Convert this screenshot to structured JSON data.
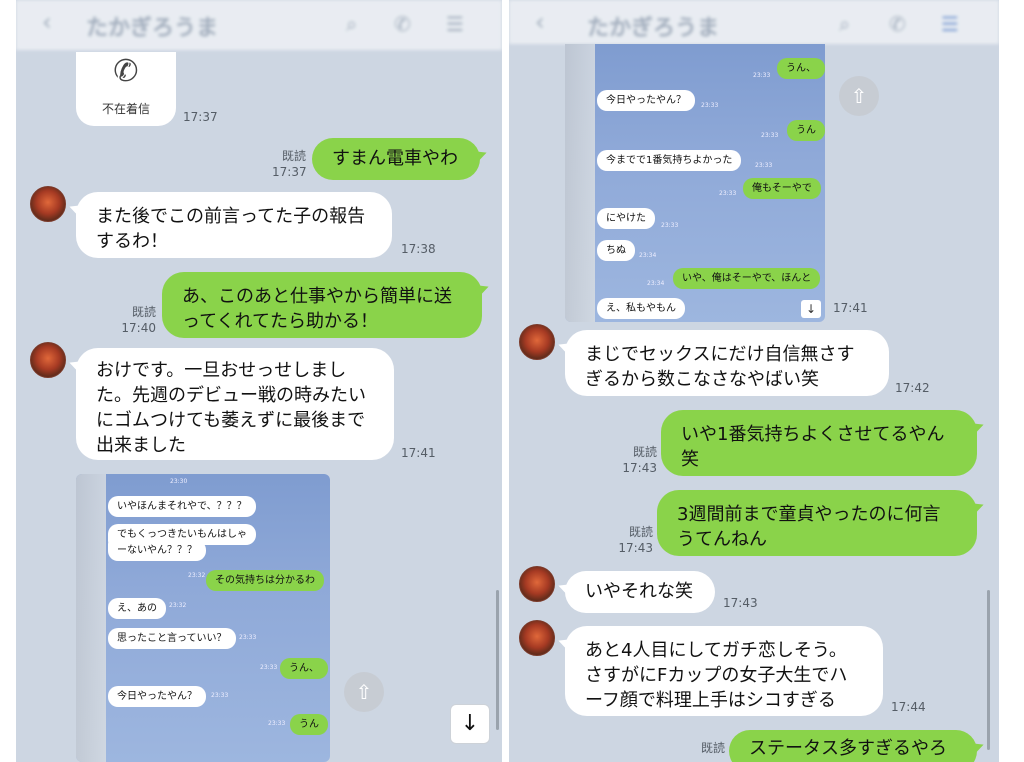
{
  "header": {
    "title": "たかぎろうま"
  },
  "left": {
    "missed_call": {
      "label": "不在着信",
      "time": "17:37"
    },
    "messages": [
      {
        "side": "right",
        "read": "既読",
        "time": "17:37",
        "text": "すまん電車やわ"
      },
      {
        "side": "left",
        "time": "17:38",
        "lines": [
          "また後でこの前言ってた子の報告",
          "するわ！"
        ]
      },
      {
        "side": "right",
        "read": "既読",
        "time": "17:40",
        "lines": [
          "あ、このあと仕事やから簡単に送",
          "ってくれてたら助かる！"
        ]
      },
      {
        "side": "left",
        "time": "17:41",
        "lines": [
          "おけです。一旦おせっせしまし",
          "た。先週のデビュー戦の時みたい",
          "にゴムつけても萎えずに最後まで",
          "出来ました"
        ]
      }
    ],
    "screenshot": {
      "items": [
        {
          "side": "left",
          "text": "いやほんまそれやで、？？？"
        },
        {
          "side": "left",
          "text": "でもくっつきたいもんはしゃ"
        },
        {
          "side": "left",
          "text": "ーないやん？？？"
        },
        {
          "side": "right",
          "text": "その気持ちは分かるわ"
        },
        {
          "side": "left",
          "text": "え、あの"
        },
        {
          "side": "left",
          "text": "思ったこと言っていい？"
        },
        {
          "side": "right",
          "text": "うん、"
        },
        {
          "side": "left",
          "text": "今日やったやん？"
        },
        {
          "side": "right",
          "text": "うん"
        }
      ],
      "mini_times": [
        "23:30",
        "23:32",
        "23:32",
        "23:33",
        "23:33",
        "23:33",
        "23:33"
      ]
    }
  },
  "right": {
    "screenshot": {
      "items": [
        {
          "side": "right",
          "text": "うん、"
        },
        {
          "side": "left",
          "text": "今日やったやん？"
        },
        {
          "side": "right",
          "text": "うん"
        },
        {
          "side": "left",
          "text": "今までで1番気持ちよかった"
        },
        {
          "side": "right",
          "text": "俺もそーやで"
        },
        {
          "side": "left",
          "text": "にやけた"
        },
        {
          "side": "left",
          "text": "ちぬ"
        },
        {
          "side": "right",
          "text": "いや、俺はそーやで、ほんと"
        },
        {
          "side": "left",
          "text": "え、私もやもん"
        }
      ],
      "time": "17:41",
      "mini_times": [
        "23:33",
        "23:33",
        "23:33",
        "23:33",
        "23:33",
        "23:33",
        "23:34",
        "23:34"
      ]
    },
    "messages": [
      {
        "side": "left",
        "time": "17:42",
        "lines": [
          "まじでセックスにだけ自信無さす",
          "ぎるから数こなさなやばい笑"
        ]
      },
      {
        "side": "right",
        "read": "既読",
        "time": "17:43",
        "lines": [
          "いや1番気持ちよくさせてるやん",
          "笑"
        ]
      },
      {
        "side": "right",
        "read": "既読",
        "time": "17:43",
        "lines": [
          "3週間前まで童貞やったのに何言",
          "うてんねん"
        ]
      },
      {
        "side": "left",
        "time": "17:43",
        "text": "いやそれな笑"
      },
      {
        "side": "left",
        "time": "17:44",
        "lines": [
          "あと4人目にしてガチ恋しそう。",
          "さすがにFカップの女子大生でハ",
          "ーフ顔で料理上手はシコすぎる"
        ]
      },
      {
        "side": "right",
        "read": "既読",
        "text": "ステータス多すぎるやろ"
      }
    ]
  },
  "icons": {
    "back": "‹",
    "search": "⌕",
    "phone": "✆",
    "menu": "☰",
    "share": "⇧",
    "down": "↓"
  },
  "colors": {
    "chat_bg": "#cdd6e2",
    "bubble_green": "#8ad34a",
    "bubble_white": "#ffffff"
  }
}
